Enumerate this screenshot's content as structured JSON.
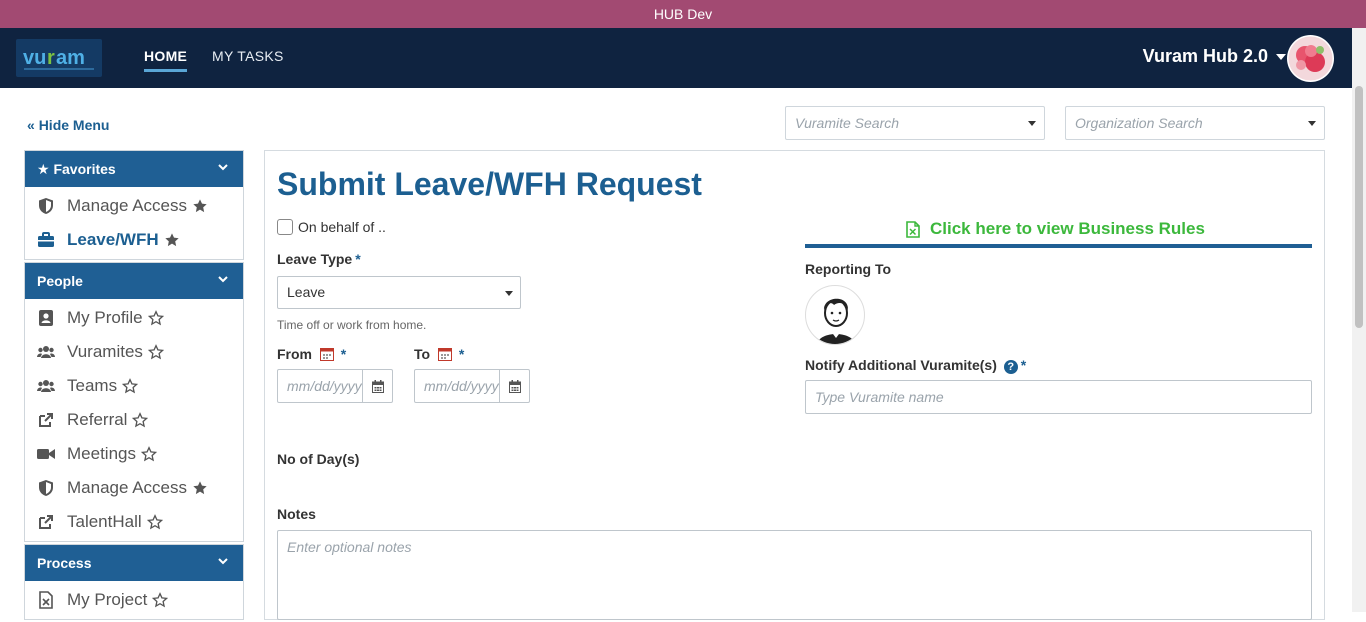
{
  "window": {
    "title": "HUB Dev"
  },
  "topnav": {
    "logo_text": "vuram",
    "links": [
      {
        "label": "HOME",
        "active": true
      },
      {
        "label": "MY TASKS",
        "active": false
      }
    ],
    "brand": "Vuram Hub 2.0"
  },
  "toolbar": {
    "hide_menu": "Hide Menu",
    "vuramite_search_placeholder": "Vuramite Search",
    "organization_search_placeholder": "Organization Search"
  },
  "sidebar": {
    "groups": [
      {
        "title": "Favorites",
        "items": [
          {
            "label": "Manage Access",
            "icon": "shield-icon",
            "favorite": true
          },
          {
            "label": "Leave/WFH",
            "icon": "briefcase-icon",
            "favorite": true,
            "active": true
          }
        ]
      },
      {
        "title": "People",
        "items": [
          {
            "label": "My Profile",
            "icon": "contact-card-icon",
            "favorite": false
          },
          {
            "label": "Vuramites",
            "icon": "users-icon",
            "favorite": false
          },
          {
            "label": "Teams",
            "icon": "users-icon",
            "favorite": false
          },
          {
            "label": "Referral",
            "icon": "share-icon",
            "favorite": false
          },
          {
            "label": "Meetings",
            "icon": "video-icon",
            "favorite": false
          },
          {
            "label": "Manage Access",
            "icon": "shield-icon",
            "favorite": true
          },
          {
            "label": "TalentHall",
            "icon": "share-icon",
            "favorite": false
          }
        ]
      },
      {
        "title": "Process",
        "items": [
          {
            "label": "My Project",
            "icon": "excel-file-icon",
            "favorite": false
          }
        ]
      }
    ]
  },
  "form": {
    "title": "Submit Leave/WFH Request",
    "on_behalf_label": "On behalf of ..",
    "leave_type_label": "Leave Type",
    "required_mark": "*",
    "leave_type_value": "Leave",
    "leave_type_hint": "Time off or work from home.",
    "from_label": "From",
    "to_label": "To",
    "date_placeholder": "mm/dd/yyyy",
    "no_of_days_label": "No of Day(s)",
    "notes_label": "Notes",
    "notes_placeholder": "Enter optional notes",
    "business_rules_link": "Click here to view Business Rules",
    "reporting_to_label": "Reporting To",
    "notify_label": "Notify Additional Vuramite(s)",
    "notify_placeholder": "Type Vuramite name",
    "help_glyph": "?"
  },
  "colors": {
    "titlebar": "#a24a72",
    "nav": "#0f2340",
    "primary": "#1f5f94",
    "link_green": "#3cb83c"
  }
}
